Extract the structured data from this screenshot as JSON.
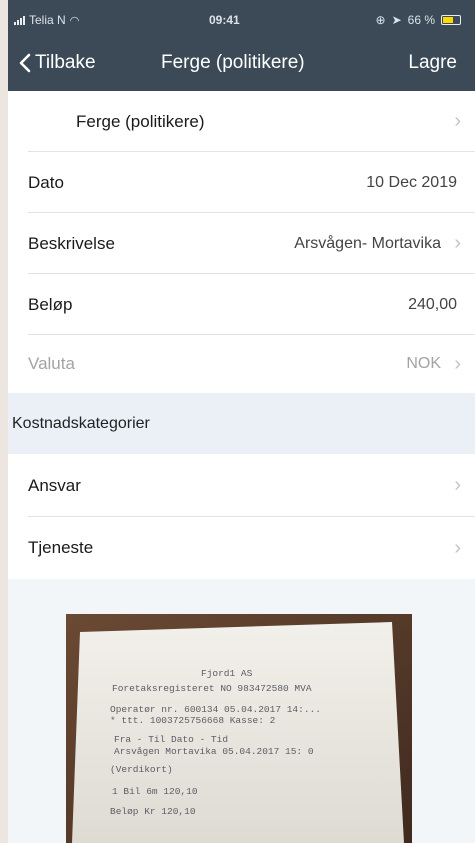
{
  "status": {
    "carrier": "Telia N",
    "time": "09:41",
    "battery": "66 %",
    "battery_level": 0.66
  },
  "nav": {
    "back_label": "Tilbake",
    "title": "Ferge (politikere)",
    "save_label": "Lagre"
  },
  "rows": [
    {
      "label": "Ferge (politikere)",
      "value": "",
      "chevron": true
    },
    {
      "label": "Dato",
      "value": "10 Dec 2019",
      "chevron": false
    },
    {
      "label": "Beskrivelse",
      "value": "Arsvågen- Mortavika",
      "chevron": true
    },
    {
      "label": "Beløp",
      "value": "240,00",
      "chevron": false
    },
    {
      "label": "Valuta",
      "value": "NOK",
      "chevron": true
    }
  ],
  "section": {
    "label": "Kostnadskategorier"
  },
  "cost_rows": [
    {
      "label": "Ansvar",
      "chevron": true
    },
    {
      "label": "Tjeneste",
      "chevron": true
    }
  ],
  "receipt": {
    "lines": [
      "Fjord1 AS",
      "Foretaksregisteret NO 983472580 MVA",
      "Operatør nr. 600134   05.04.2017 14:...",
      "* ttt. 1003725756668                Kasse: 2",
      "Fra - Til                           Dato - Tid",
      "Arsvågen  Mortavika    05.04.2017 15: 0",
      "(Verdikort)",
      "1     Bil 6m                        120,10",
      "Beløp Kr                            120,10"
    ]
  },
  "colors": {
    "header": "#3c4a57",
    "section": "#eaf0f6",
    "chevron": "#c3c3c8"
  }
}
